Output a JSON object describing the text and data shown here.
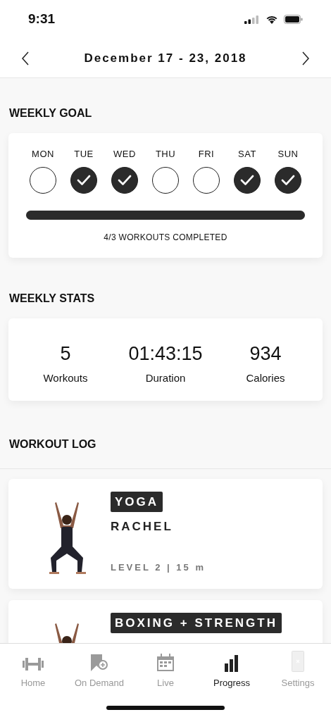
{
  "status_bar": {
    "time": "9:31"
  },
  "header": {
    "title": "December 17 - 23, 2018"
  },
  "weekly_goal": {
    "title": "WEEKLY GOAL",
    "days": [
      {
        "label": "MON",
        "checked": false
      },
      {
        "label": "TUE",
        "checked": true
      },
      {
        "label": "WED",
        "checked": true
      },
      {
        "label": "THU",
        "checked": false
      },
      {
        "label": "FRI",
        "checked": false
      },
      {
        "label": "SAT",
        "checked": true
      },
      {
        "label": "SUN",
        "checked": true
      }
    ],
    "level": 1,
    "summary": "4/3  WORKOUTS COMPLETED"
  },
  "weekly_stats": {
    "title": "WEEKLY STATS",
    "stats": [
      {
        "value": "5",
        "label": "Workouts"
      },
      {
        "value": "01:43:15",
        "label": "Duration"
      },
      {
        "value": "934",
        "label": "Calories"
      }
    ]
  },
  "workout_log": {
    "title": "WORKOUT LOG",
    "workouts": [
      {
        "kind": "picture",
        "category": "YOGA",
        "instructor": "RACHEL",
        "details": "LEVEL 2 | 15 m"
      },
      {
        "kind": "picture",
        "category": "BOXING + STRENGTH"
      }
    ]
  },
  "tab_bar": [
    {
      "label": "Home",
      "selected": false
    },
    {
      "label": "On Demand",
      "selected": false
    },
    {
      "label": "Live",
      "selected": false
    },
    {
      "label": "Progress",
      "selected": true
    },
    {
      "label": "Settings",
      "selected": false
    }
  ]
}
